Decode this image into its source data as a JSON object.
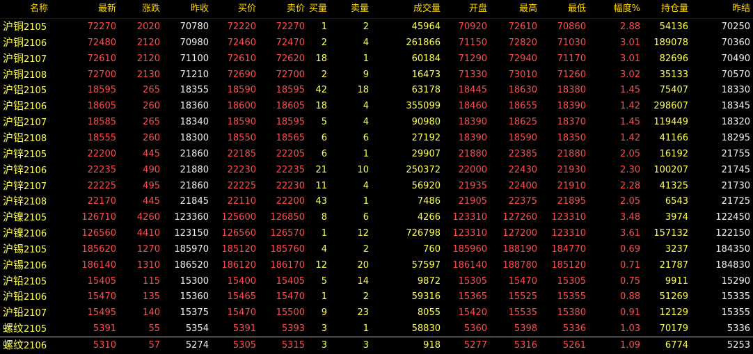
{
  "headers": [
    "名称",
    "最新",
    "涨跌",
    "昨收",
    "买价",
    "卖价",
    "买量",
    "卖量",
    "成交量",
    "开盘",
    "最高",
    "最低",
    "幅度%",
    "持仓量",
    "昨结"
  ],
  "colors": {
    "background": "#000000",
    "header": "#ffd700",
    "red": "#ff4d4d",
    "yellow": "#ffff55",
    "white": "#f0f0f0"
  },
  "rows": [
    {
      "name_cn": "沪铜",
      "code": "2105",
      "last": "72270",
      "change": "2020",
      "prev_close": "70780",
      "bid": "72220",
      "ask": "72270",
      "bid_vol": "1",
      "ask_vol": "2",
      "volume": "45964",
      "open": "70920",
      "high": "72610",
      "low": "70860",
      "range": "2.88",
      "oi": "54136",
      "prev_settle": "70250"
    },
    {
      "name_cn": "沪铜",
      "code": "2106",
      "last": "72480",
      "change": "2120",
      "prev_close": "70980",
      "bid": "72460",
      "ask": "72470",
      "bid_vol": "2",
      "ask_vol": "4",
      "volume": "261866",
      "open": "71150",
      "high": "72820",
      "low": "71030",
      "range": "3.01",
      "oi": "189078",
      "prev_settle": "70360"
    },
    {
      "name_cn": "沪铜",
      "code": "2107",
      "last": "72610",
      "change": "2120",
      "prev_close": "71100",
      "bid": "72610",
      "ask": "72620",
      "bid_vol": "18",
      "ask_vol": "1",
      "volume": "60184",
      "open": "71290",
      "high": "72940",
      "low": "71170",
      "range": "3.01",
      "oi": "82696",
      "prev_settle": "70490"
    },
    {
      "name_cn": "沪铜",
      "code": "2108",
      "last": "72700",
      "change": "2130",
      "prev_close": "71210",
      "bid": "72690",
      "ask": "72700",
      "bid_vol": "2",
      "ask_vol": "9",
      "volume": "16473",
      "open": "71330",
      "high": "73010",
      "low": "71260",
      "range": "3.02",
      "oi": "35133",
      "prev_settle": "70570"
    },
    {
      "name_cn": "沪铝",
      "code": "2105",
      "last": "18595",
      "change": "265",
      "prev_close": "18355",
      "bid": "18590",
      "ask": "18595",
      "bid_vol": "42",
      "ask_vol": "18",
      "volume": "63178",
      "open": "18445",
      "high": "18630",
      "low": "18380",
      "range": "1.45",
      "oi": "75407",
      "prev_settle": "18330"
    },
    {
      "name_cn": "沪铝",
      "code": "2106",
      "last": "18605",
      "change": "260",
      "prev_close": "18360",
      "bid": "18600",
      "ask": "18605",
      "bid_vol": "18",
      "ask_vol": "4",
      "volume": "355099",
      "open": "18460",
      "high": "18655",
      "low": "18390",
      "range": "1.42",
      "oi": "298607",
      "prev_settle": "18345"
    },
    {
      "name_cn": "沪铝",
      "code": "2107",
      "last": "18585",
      "change": "265",
      "prev_close": "18340",
      "bid": "18590",
      "ask": "18595",
      "bid_vol": "5",
      "ask_vol": "4",
      "volume": "90980",
      "open": "18390",
      "high": "18625",
      "low": "18370",
      "range": "1.45",
      "oi": "119449",
      "prev_settle": "18320"
    },
    {
      "name_cn": "沪铝",
      "code": "2108",
      "last": "18555",
      "change": "260",
      "prev_close": "18300",
      "bid": "18550",
      "ask": "18565",
      "bid_vol": "6",
      "ask_vol": "6",
      "volume": "27192",
      "open": "18390",
      "high": "18590",
      "low": "18350",
      "range": "1.42",
      "oi": "41166",
      "prev_settle": "18295"
    },
    {
      "name_cn": "沪锌",
      "code": "2105",
      "last": "22200",
      "change": "445",
      "prev_close": "21860",
      "bid": "22185",
      "ask": "22205",
      "bid_vol": "6",
      "ask_vol": "1",
      "volume": "29907",
      "open": "21880",
      "high": "22385",
      "low": "21880",
      "range": "2.05",
      "oi": "16192",
      "prev_settle": "21755"
    },
    {
      "name_cn": "沪锌",
      "code": "2106",
      "last": "22235",
      "change": "490",
      "prev_close": "21880",
      "bid": "22230",
      "ask": "22235",
      "bid_vol": "21",
      "ask_vol": "10",
      "volume": "250372",
      "open": "22000",
      "high": "22430",
      "low": "21930",
      "range": "2.30",
      "oi": "100207",
      "prev_settle": "21745"
    },
    {
      "name_cn": "沪锌",
      "code": "2107",
      "last": "22225",
      "change": "495",
      "prev_close": "21860",
      "bid": "22225",
      "ask": "22230",
      "bid_vol": "11",
      "ask_vol": "4",
      "volume": "56920",
      "open": "21935",
      "high": "22400",
      "low": "21910",
      "range": "2.28",
      "oi": "41325",
      "prev_settle": "21730"
    },
    {
      "name_cn": "沪锌",
      "code": "2108",
      "last": "22170",
      "change": "445",
      "prev_close": "21845",
      "bid": "22110",
      "ask": "22200",
      "bid_vol": "43",
      "ask_vol": "1",
      "volume": "7486",
      "open": "21905",
      "high": "22375",
      "low": "21895",
      "range": "2.05",
      "oi": "6543",
      "prev_settle": "21725"
    },
    {
      "name_cn": "沪镍",
      "code": "2105",
      "last": "126710",
      "change": "4260",
      "prev_close": "123360",
      "bid": "125600",
      "ask": "126850",
      "bid_vol": "8",
      "ask_vol": "6",
      "volume": "4266",
      "open": "123310",
      "high": "127260",
      "low": "123310",
      "range": "3.48",
      "oi": "3974",
      "prev_settle": "122450"
    },
    {
      "name_cn": "沪镍",
      "code": "2106",
      "last": "126560",
      "change": "4410",
      "prev_close": "123150",
      "bid": "126560",
      "ask": "126570",
      "bid_vol": "1",
      "ask_vol": "12",
      "volume": "726798",
      "open": "123310",
      "high": "127200",
      "low": "123310",
      "range": "3.61",
      "oi": "157132",
      "prev_settle": "122150"
    },
    {
      "name_cn": "沪锡",
      "code": "2105",
      "last": "185620",
      "change": "1270",
      "prev_close": "185970",
      "bid": "185120",
      "ask": "185760",
      "bid_vol": "4",
      "ask_vol": "2",
      "volume": "760",
      "open": "185960",
      "high": "188190",
      "low": "184770",
      "range": "0.69",
      "oi": "3237",
      "prev_settle": "184350"
    },
    {
      "name_cn": "沪锡",
      "code": "2106",
      "last": "186140",
      "change": "1310",
      "prev_close": "186520",
      "bid": "186120",
      "ask": "186170",
      "bid_vol": "12",
      "ask_vol": "20",
      "volume": "57597",
      "open": "186140",
      "high": "188780",
      "low": "185120",
      "range": "0.71",
      "oi": "21787",
      "prev_settle": "184830"
    },
    {
      "name_cn": "沪铅",
      "code": "2105",
      "last": "15405",
      "change": "115",
      "prev_close": "15300",
      "bid": "15400",
      "ask": "15405",
      "bid_vol": "5",
      "ask_vol": "14",
      "volume": "9872",
      "open": "15305",
      "high": "15470",
      "low": "15305",
      "range": "0.75",
      "oi": "9911",
      "prev_settle": "15290"
    },
    {
      "name_cn": "沪铅",
      "code": "2106",
      "last": "15470",
      "change": "135",
      "prev_close": "15360",
      "bid": "15465",
      "ask": "15470",
      "bid_vol": "1",
      "ask_vol": "2",
      "volume": "59316",
      "open": "15365",
      "high": "15525",
      "low": "15355",
      "range": "0.88",
      "oi": "51269",
      "prev_settle": "15335"
    },
    {
      "name_cn": "沪铅",
      "code": "2107",
      "last": "15495",
      "change": "140",
      "prev_close": "15375",
      "bid": "15470",
      "ask": "15500",
      "bid_vol": "9",
      "ask_vol": "23",
      "volume": "8055",
      "open": "15420",
      "high": "15535",
      "low": "15380",
      "range": "0.91",
      "oi": "12129",
      "prev_settle": "15355"
    },
    {
      "name_cn": "螺纹",
      "code": "2105",
      "last": "5391",
      "change": "55",
      "prev_close": "5354",
      "bid": "5391",
      "ask": "5393",
      "bid_vol": "3",
      "ask_vol": "1",
      "volume": "58830",
      "open": "5360",
      "high": "5398",
      "low": "5336",
      "range": "1.03",
      "oi": "70179",
      "prev_settle": "5336"
    },
    {
      "name_cn": "螺纹",
      "code": "2106",
      "last": "5310",
      "change": "57",
      "prev_close": "5274",
      "bid": "5305",
      "ask": "5315",
      "bid_vol": "3",
      "ask_vol": "3",
      "volume": "918",
      "open": "5277",
      "high": "5316",
      "low": "5261",
      "range": "1.09",
      "oi": "6774",
      "prev_settle": "5253"
    }
  ]
}
